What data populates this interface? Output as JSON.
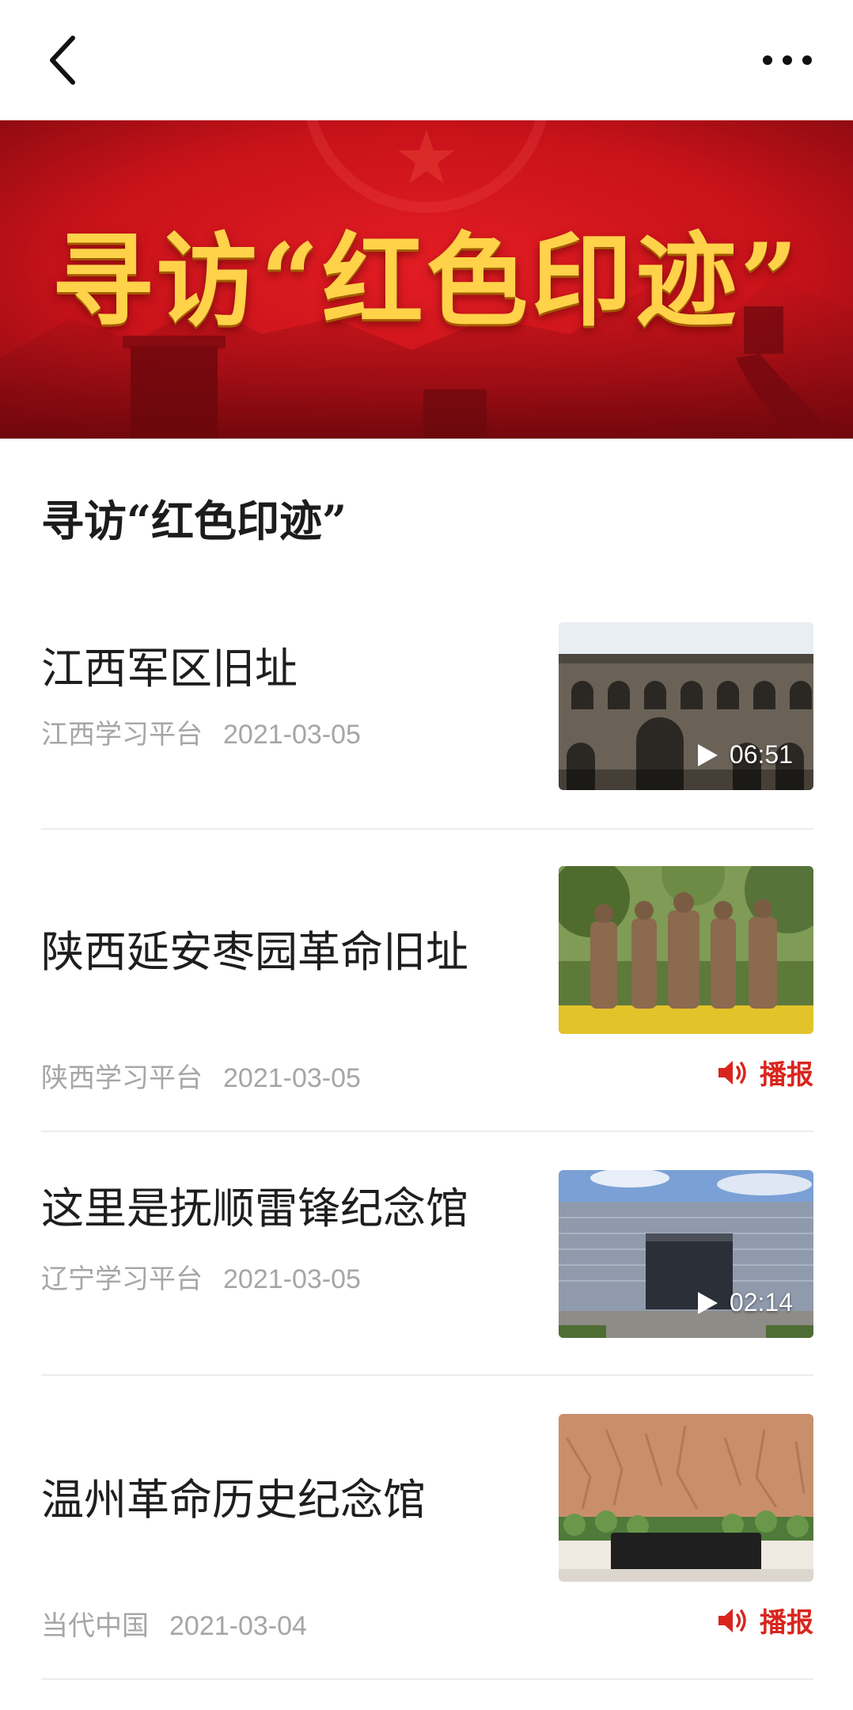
{
  "header": {
    "back_icon": "chevron-left-icon",
    "more_icon": "more-dots-icon"
  },
  "banner": {
    "title": "寻访“红色印迹”"
  },
  "section": {
    "title": "寻访“红色印迹”"
  },
  "items": [
    {
      "title": "江西军区旧址",
      "source": "江西学习平台",
      "date": "2021-03-05",
      "duration": "06:51"
    },
    {
      "title": "陕西延安枣园革命旧址",
      "source": "陕西学习平台",
      "date": "2021-03-05",
      "broadcast": "播报"
    },
    {
      "title": "这里是抚顺雷锋纪念馆",
      "source": "辽宁学习平台",
      "date": "2021-03-05",
      "duration": "02:14"
    },
    {
      "title": "温州革命历史纪念馆",
      "source": "当代中国",
      "date": "2021-03-04",
      "broadcast": "播报"
    }
  ],
  "colors": {
    "accent": "#d8261e",
    "banner_red": "#c8121a",
    "banner_gold": "#ffd24a",
    "meta_gray": "#a6a6a6"
  }
}
